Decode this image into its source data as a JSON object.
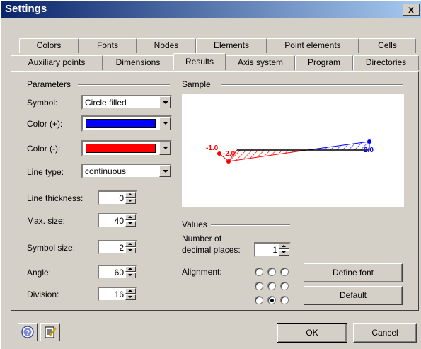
{
  "window": {
    "title": "Settings",
    "close_glyph": "x"
  },
  "tabs_row1": [
    "Colors",
    "Fonts",
    "Nodes",
    "Elements",
    "Point elements",
    "Cells"
  ],
  "tabs_row2": [
    "Auxiliary points",
    "Dimensions",
    "Results",
    "Axis system",
    "Program",
    "Directories"
  ],
  "active_tab": "Results",
  "parameters": {
    "group_label": "Parameters",
    "symbol_label": "Symbol:",
    "symbol_value": "Circle filled",
    "color_pos_label": "Color (+):",
    "color_pos_value": "#0000ff",
    "color_neg_label": "Color (-):",
    "color_neg_value": "#ff0000",
    "line_type_label": "Line type:",
    "line_type_value": "continuous",
    "line_thickness_label": "Line thickness:",
    "line_thickness_value": "0",
    "max_size_label": "Max. size:",
    "max_size_value": "40",
    "symbol_size_label": "Symbol size:",
    "symbol_size_value": "2",
    "angle_label": "Angle:",
    "angle_value": "60",
    "division_label": "Division:",
    "division_value": "16"
  },
  "sample": {
    "group_label": "Sample",
    "label_neg_outer": "-1.0",
    "label_neg_inner": "-2.0",
    "label_pos": "2.0"
  },
  "values": {
    "group_label": "Values",
    "decimal_label_line1": "Number of",
    "decimal_label_line2": "decimal places:",
    "decimal_value": "1",
    "alignment_label": "Alignment:",
    "alignment_selected": "bottom-center"
  },
  "buttons": {
    "define_font": "Define font",
    "default": "Default",
    "ok": "OK",
    "cancel": "Cancel"
  },
  "icons": {
    "help": "help-icon",
    "edit": "edit-icon"
  },
  "colors": {
    "titlebar_start": "#0a246a",
    "face": "#d4d0c8",
    "positive": "#0000ff",
    "negative": "#ff0000"
  }
}
